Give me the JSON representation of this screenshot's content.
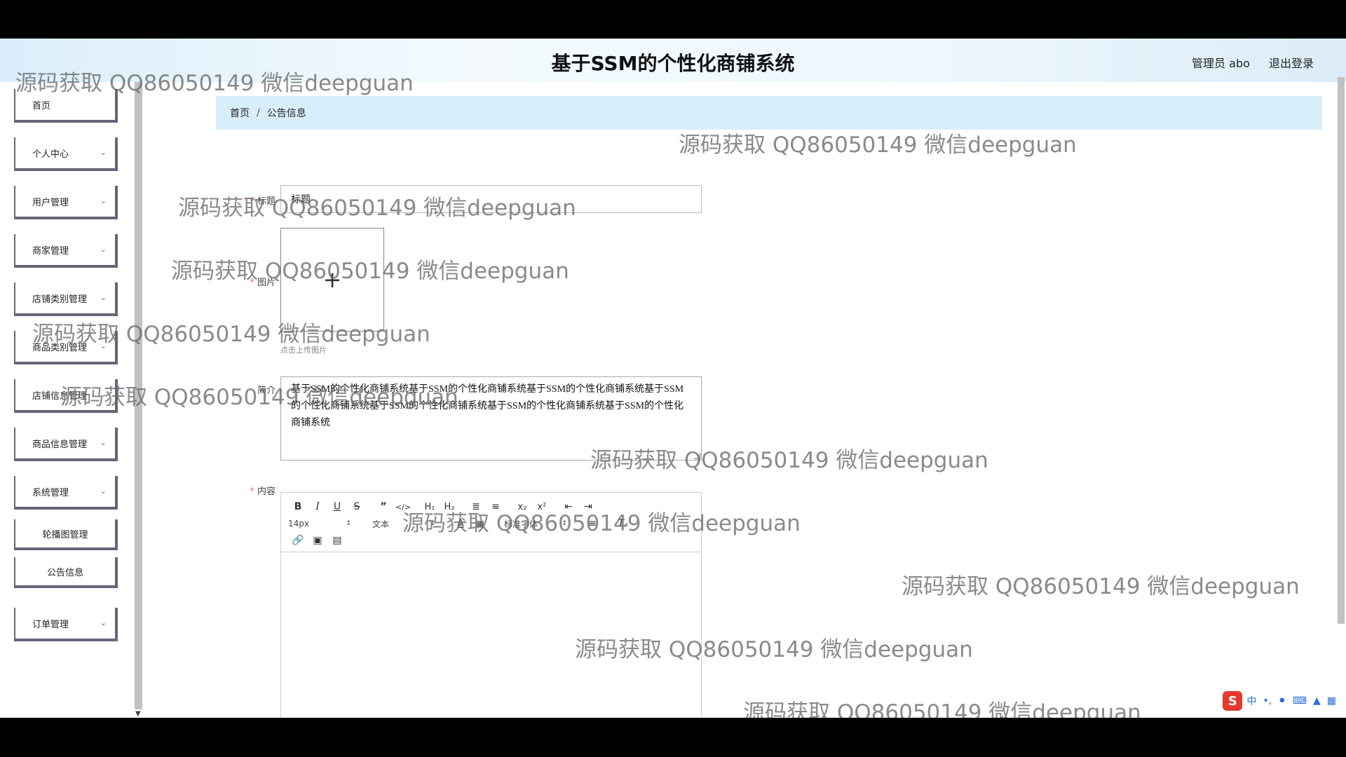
{
  "app": {
    "title": "基于SSM的个性化商铺系统"
  },
  "header": {
    "user_label": "管理员 abo",
    "logout_label": "退出登录"
  },
  "sidebar": {
    "items": [
      {
        "label": "首页",
        "has_arrow": false
      },
      {
        "label": "个人中心",
        "has_arrow": true
      },
      {
        "label": "用户管理",
        "has_arrow": true
      },
      {
        "label": "商家管理",
        "has_arrow": true
      },
      {
        "label": "店铺类别管理",
        "has_arrow": true
      },
      {
        "label": "商品类别管理",
        "has_arrow": true
      },
      {
        "label": "店铺信息管理",
        "has_arrow": true
      },
      {
        "label": "商品信息管理",
        "has_arrow": true
      },
      {
        "label": "系统管理",
        "has_arrow": true
      },
      {
        "label": "轮播图管理",
        "has_arrow": false
      },
      {
        "label": "公告信息",
        "has_arrow": false
      },
      {
        "label": "订单管理",
        "has_arrow": true
      }
    ]
  },
  "breadcrumb": {
    "home": "首页",
    "separator": "/",
    "current": "公告信息"
  },
  "form": {
    "title_label": "标题",
    "title_value": "标题",
    "image_label": "图片",
    "upload_tip": "点击上传图片",
    "intro_label": "简介",
    "intro_value": "基于SSM的个性化商铺系统基于SSM的个性化商铺系统基于SSM的个性化商铺系统基于SSM的个性化商铺系统基于SSM的个性化商铺系统基于SSM的个性化商铺系统基于SSM的个性化商铺系统",
    "content_label": "内容",
    "required_mark": "*"
  },
  "editor": {
    "font_size": "14px",
    "text_type": "文本",
    "font_family": "标准字体"
  },
  "watermark": {
    "text": "源码获取 QQ86050149 微信deepguan"
  },
  "ime": {
    "lang": "中"
  }
}
